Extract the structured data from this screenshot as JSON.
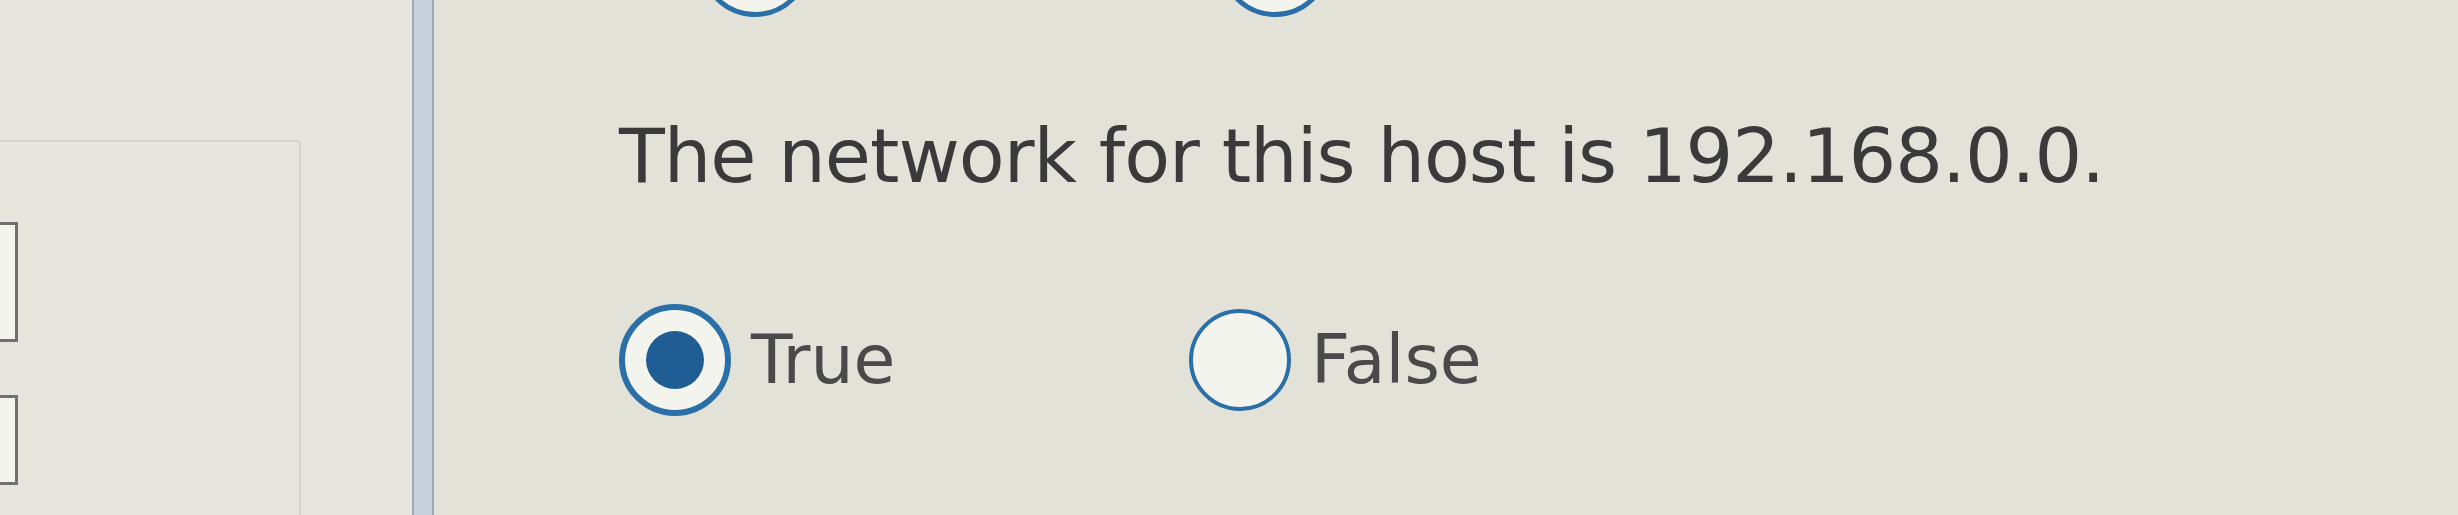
{
  "previous_question": {
    "options": [
      {
        "selected": false
      },
      {
        "selected": false
      }
    ]
  },
  "question": {
    "text": "The network for this host is 192.168.0.0.",
    "options": [
      {
        "label": "True",
        "selected": true
      },
      {
        "label": "False",
        "selected": false
      }
    ]
  }
}
